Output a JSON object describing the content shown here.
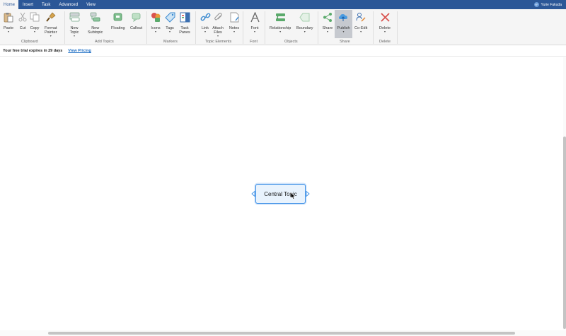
{
  "tabs": [
    "Home",
    "Insert",
    "Task",
    "Advanced",
    "View"
  ],
  "active_tab": "Home",
  "user": {
    "name": "Yurie Fukuda",
    "initials": "YF"
  },
  "ribbon": {
    "paste": "Paste",
    "cut": "Cut",
    "copy": "Copy",
    "format_painter": "Format\nPainter",
    "new_topic": "New\nTopic",
    "new_subtopic": "New\nSubtopic",
    "floating": "Floating",
    "callout": "Callout",
    "icons": "Icons",
    "tags": "Tags",
    "task_panes": "Task\nPanes",
    "link": "Link",
    "attach_files": "Attach\nFiles",
    "notes": "Notes",
    "font": "Font",
    "relationship": "Relationship",
    "boundary": "Boundary",
    "share": "Share",
    "publish": "Publish",
    "co_edit": "Co-Edit",
    "delete": "Delete"
  },
  "groups": {
    "clipboard": "Clipboard",
    "add_topics": "Add Topics",
    "markers": "Markers",
    "topic_elements": "Topic Elements",
    "font": "Font",
    "objects": "Objects",
    "share": "Share",
    "delete": "Delete"
  },
  "trial": {
    "message": "Your free trial expires in 29 days",
    "link": "View Pricing"
  },
  "central_topic": "Central Topic",
  "colors": {
    "tabbar": "#2b5797",
    "topic_border": "#3a8ee6",
    "topic_fill": "#e9f3fd",
    "link": "#1f6fc5"
  },
  "icon_names": [
    "paste-icon",
    "cut-icon",
    "copy-icon",
    "format-painter-icon",
    "new-topic-icon",
    "new-subtopic-icon",
    "floating-icon",
    "callout-icon",
    "icons-icon",
    "tags-icon",
    "task-panes-icon",
    "link-icon",
    "attach-icon",
    "notes-icon",
    "font-icon",
    "relationship-icon",
    "boundary-icon",
    "share-icon",
    "publish-icon",
    "co-edit-icon",
    "delete-icon"
  ]
}
